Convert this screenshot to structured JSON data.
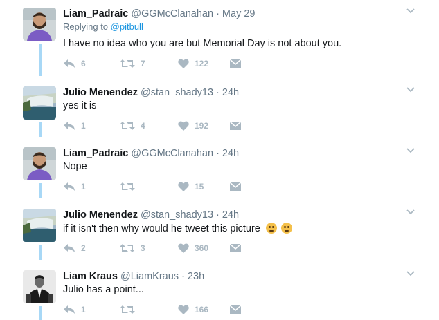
{
  "tweets": [
    {
      "name": "Liam_Padraic",
      "handle": "@GGMcClanahan",
      "time": "· May 29",
      "replying_label": "Replying to",
      "replying_handle": "@pitbull",
      "text": "I have no idea who you are but Memorial Day is not about you.",
      "replies": "6",
      "retweets": "7",
      "likes": "122",
      "avatar": "man-beard-purple-shirt"
    },
    {
      "name": "Julio Menendez",
      "handle": "@stan_shady13",
      "time": "· 24h",
      "text": "yes it is",
      "replies": "1",
      "retweets": "4",
      "likes": "192",
      "avatar": "waterfall-landscape"
    },
    {
      "name": "Liam_Padraic",
      "handle": "@GGMcClanahan",
      "time": "· 24h",
      "text": "Nope",
      "replies": "1",
      "retweets": "",
      "likes": "15",
      "avatar": "man-beard-purple-shirt"
    },
    {
      "name": "Julio Menendez",
      "handle": "@stan_shady13",
      "time": "· 24h",
      "text": "if it isn't then why would he tweet this picture",
      "emoji": [
        "thinking-face-emoji",
        "thinking-face-emoji"
      ],
      "replies": "2",
      "retweets": "3",
      "likes": "360",
      "avatar": "waterfall-landscape"
    },
    {
      "name": "Liam Kraus",
      "handle": "@LiamKraus",
      "time": "· 23h",
      "text": "Julio has a point...",
      "replies": "1",
      "retweets": "",
      "likes": "166",
      "avatar": "man-black-and-white-suit"
    }
  ],
  "colors": {
    "thread_line": "#a8d8f6",
    "link": "#1b95e0",
    "muted": "#657786",
    "icon": "#aab8c2"
  }
}
